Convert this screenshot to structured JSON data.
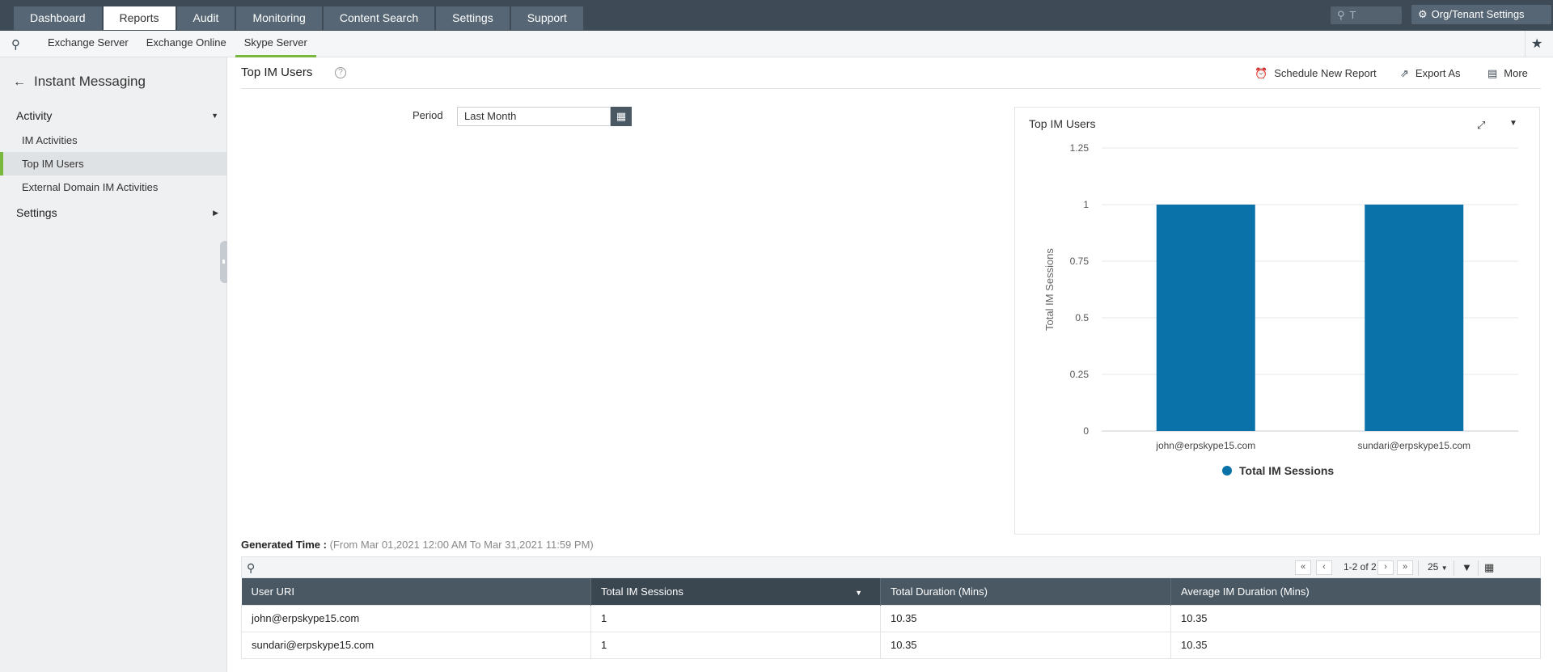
{
  "nav": {
    "tabs": [
      {
        "label": "Dashboard"
      },
      {
        "label": "Reports"
      },
      {
        "label": "Audit"
      },
      {
        "label": "Monitoring"
      },
      {
        "label": "Content Search"
      },
      {
        "label": "Settings"
      },
      {
        "label": "Support"
      }
    ],
    "active_tab": "Reports",
    "search_value": "T",
    "org_settings_label": "Org/Tenant Settings"
  },
  "subnav": {
    "tabs": [
      {
        "label": "Exchange Server"
      },
      {
        "label": "Exchange Online"
      },
      {
        "label": "Skype Server"
      }
    ],
    "active_tab": "Skype Server"
  },
  "sidebar": {
    "title": "Instant Messaging",
    "groups": [
      {
        "label": "Activity",
        "expanded": true
      },
      {
        "label": "Settings",
        "expanded": false
      }
    ],
    "items": [
      {
        "label": "IM Activities"
      },
      {
        "label": "Top IM Users"
      },
      {
        "label": "External Domain IM Activities"
      }
    ],
    "active_item": "Top IM Users"
  },
  "report": {
    "title": "Top IM Users",
    "help_glyph": "?",
    "actions": {
      "schedule": "Schedule New Report",
      "export": "Export As",
      "more": "More"
    },
    "period_label": "Period",
    "period_value": "Last Month",
    "generated_label": "Generated Time :",
    "generated_value": "(From Mar 01,2021 12:00 AM To Mar 31,2021 11:59 PM)"
  },
  "chart_data": {
    "type": "bar",
    "title": "Top IM Users",
    "categories": [
      "john@erpskype15.com",
      "sundari@erpskype15.com"
    ],
    "series": [
      {
        "name": "Total IM Sessions",
        "values": [
          1,
          1
        ],
        "color": "#0a72a8"
      }
    ],
    "ylabel": "Total IM Sessions",
    "xlabel": "",
    "ylim": [
      0,
      1.25
    ],
    "yticks": [
      "0",
      "0.25",
      "0.5",
      "0.75",
      "1",
      "1.25"
    ],
    "ytick_values": [
      0,
      0.25,
      0.5,
      0.75,
      1,
      1.25
    ],
    "grid": true,
    "legend": "bottom-center"
  },
  "table": {
    "pagination": "1-2 of 2",
    "page_size": "25",
    "columns": [
      "User URI",
      "Total IM Sessions",
      "Total Duration (Mins)",
      "Average IM Duration (Mins)"
    ],
    "sorted_column": "Total IM Sessions",
    "rows": [
      [
        "john@erpskype15.com",
        "1",
        "10.35",
        "10.35"
      ],
      [
        "sundari@erpskype15.com",
        "1",
        "10.35",
        "10.35"
      ]
    ]
  }
}
